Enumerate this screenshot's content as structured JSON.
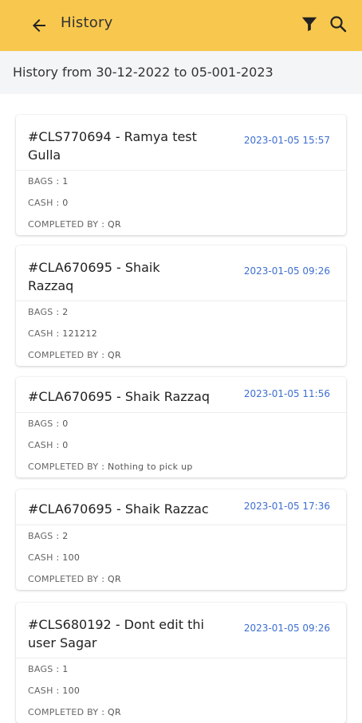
{
  "header": {
    "title": "History",
    "icons": [
      "back-arrow-icon",
      "filter-icon",
      "search-icon"
    ],
    "background_color": "#F8C84E"
  },
  "range": {
    "text": "History from 30-12-2022 to 05-001-2023"
  },
  "labels": {
    "bags": "BAGS",
    "cash": "CASH",
    "completed_by": "COMPLETED BY"
  },
  "accent_color": "#3D6FD1",
  "items": [
    {
      "title": "#CLS770694  - Ramya test Gulla",
      "date": "2023-01-05 15:57",
      "bags": ": 1",
      "cash": ": 0",
      "completed_by": ": QR"
    },
    {
      "title": "#CLA670695  - Shaik Razzaq",
      "date": "2023-01-05 09:26",
      "bags": ": 2",
      "cash": ": 121212",
      "completed_by": ": QR"
    },
    {
      "title": "#CLA670695  - Shaik Razzaq",
      "date": "2023-01-05 11:56",
      "bags": ": 0",
      "cash": ": 0",
      "completed_by": ": Nothing to pick up"
    },
    {
      "title": "#CLA670695  - Shaik Razzac",
      "date": "2023-01-05 17:36",
      "bags": ": 2",
      "cash": ": 100",
      "completed_by": ": QR"
    },
    {
      "title": "#CLS680192  - Dont edit thi user Sagar",
      "date": "2023-01-05 09:26",
      "bags": ": 1",
      "cash": ": 100",
      "completed_by": ": QR"
    }
  ]
}
